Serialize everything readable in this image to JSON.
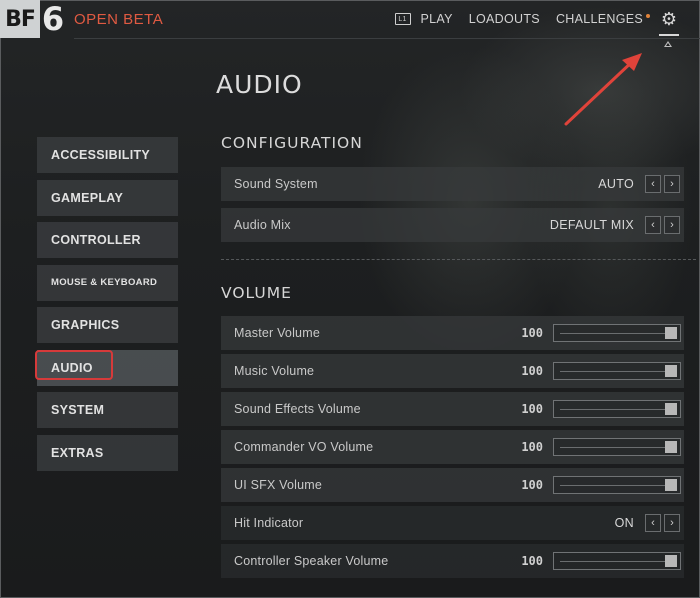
{
  "header": {
    "logo_bf": "BF",
    "logo_num": "6",
    "beta_label": "OPEN BETA",
    "nav": [
      "PLAY",
      "LOADOUTS",
      "CHALLENGES"
    ],
    "play_icon_glyph": "L1"
  },
  "page": {
    "title": "AUDIO"
  },
  "sidebar": {
    "items": [
      {
        "label": "ACCESSIBILITY"
      },
      {
        "label": "GAMEPLAY"
      },
      {
        "label": "CONTROLLER"
      },
      {
        "label": "MOUSE & KEYBOARD"
      },
      {
        "label": "GRAPHICS"
      },
      {
        "label": "AUDIO"
      },
      {
        "label": "SYSTEM"
      },
      {
        "label": "EXTRAS"
      }
    ],
    "active": "AUDIO"
  },
  "configuration": {
    "title": "CONFIGURATION",
    "rows": [
      {
        "label": "Sound System",
        "value": "AUTO"
      },
      {
        "label": "Audio Mix",
        "value": "DEFAULT MIX"
      }
    ]
  },
  "volume": {
    "title": "VOLUME",
    "rows": [
      {
        "label": "Master Volume",
        "value": "100"
      },
      {
        "label": "Music Volume",
        "value": "100"
      },
      {
        "label": "Sound Effects Volume",
        "value": "100"
      },
      {
        "label": "Commander VO Volume",
        "value": "100"
      },
      {
        "label": "UI SFX Volume",
        "value": "100"
      },
      {
        "label": "Hit Indicator",
        "value": "ON"
      },
      {
        "label": "Controller Speaker Volume",
        "value": "100"
      }
    ]
  },
  "icons": {
    "settings": "gear-icon",
    "arrow_left": "‹",
    "arrow_right": "›"
  },
  "colors": {
    "accent_red": "#e05a42",
    "highlight_border": "#d63a3a",
    "annotation_arrow": "#e0433a",
    "notification_dot": "#e0833a"
  }
}
